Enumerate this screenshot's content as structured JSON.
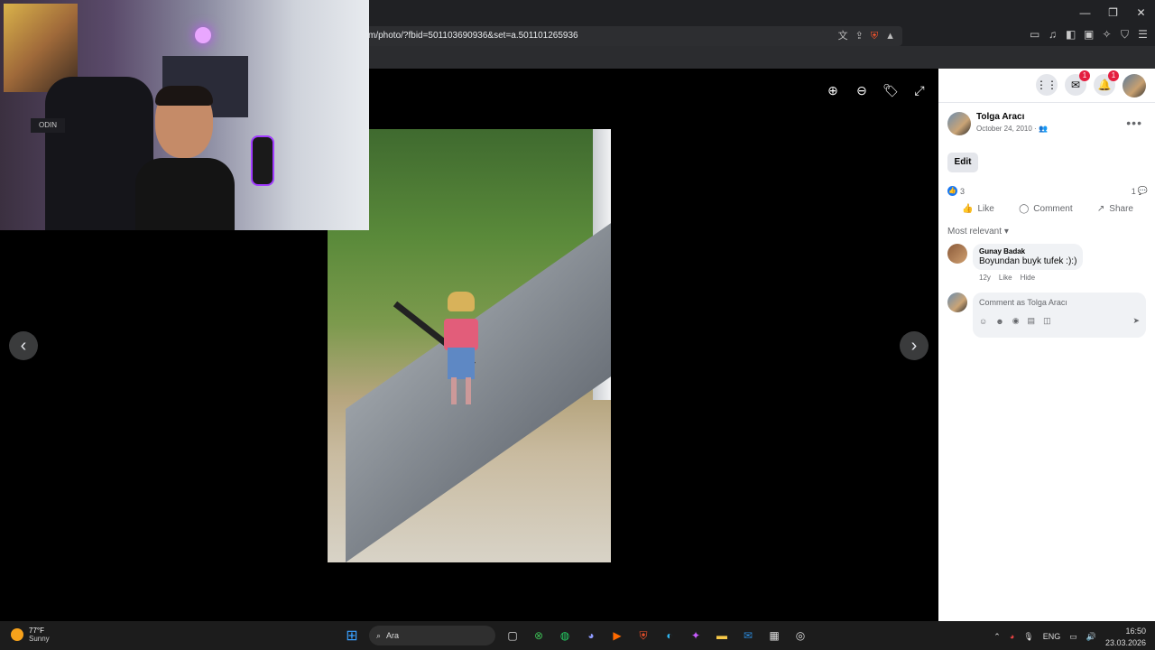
{
  "browser": {
    "url": "m/photo/?fbid=501103690936&set=a.501101265936",
    "win_minimize": "—",
    "win_restore": "❐",
    "win_close": "✕"
  },
  "viewer": {
    "prev_label": "‹",
    "next_label": "›"
  },
  "webcam": {
    "box_label": "ODIN"
  },
  "facebook": {
    "messenger_badge": "1",
    "notifications_badge": "1",
    "post": {
      "author": "Tolga Aracı",
      "date": "October 24, 2010 ·",
      "edit_label": "Edit",
      "reactions_count": "3",
      "comments_count": "1",
      "actions": {
        "like": "Like",
        "comment": "Comment",
        "share": "Share"
      },
      "sort_label": "Most relevant",
      "comments": [
        {
          "name": "Gunay Badak",
          "text": "Boyundan buyk tufek :):)",
          "age": "12y",
          "like": "Like",
          "hide": "Hide"
        }
      ],
      "composer_placeholder": "Comment as Tolga Aracı"
    }
  },
  "taskbar": {
    "weather_temp": "77°F",
    "weather_cond": "Sunny",
    "search_label": "Ara",
    "language": "ENG",
    "time": "16:50",
    "date": "23.03.2026"
  },
  "colors": {
    "fb_blue": "#1877f2",
    "badge_red": "#e41e3f",
    "brave_orange": "#fb542b"
  }
}
